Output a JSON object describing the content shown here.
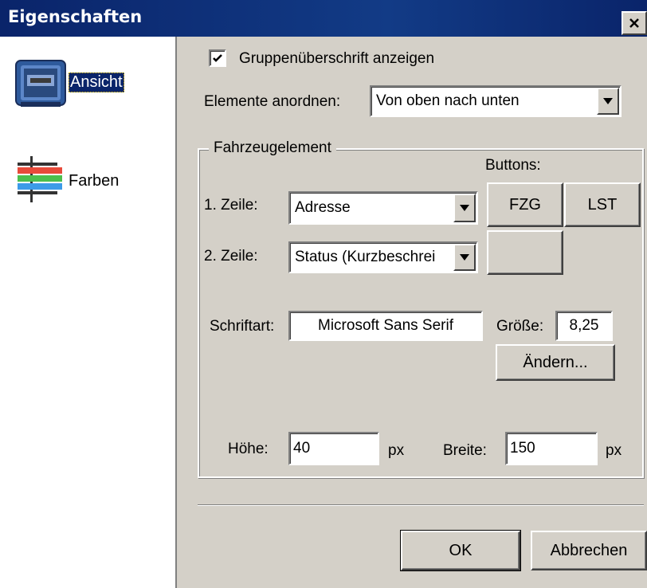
{
  "window": {
    "title": "Eigenschaften"
  },
  "sidebar": {
    "items": [
      {
        "label": "Ansicht",
        "icon": "display-icon",
        "selected": true
      },
      {
        "label": "Farben",
        "icon": "color-bars-icon",
        "selected": false
      }
    ]
  },
  "options": {
    "show_group_header_label": "Gruppenüberschrift anzeigen",
    "show_group_header_checked": true,
    "arrange_label": "Elemente anordnen:",
    "arrange_value": "Von oben nach unten"
  },
  "vehicle_element": {
    "group_title": "Fahrzeugelement",
    "buttons_label": "Buttons:",
    "row1_label": "1. Zeile:",
    "row1_value": "Adresse",
    "row2_label": "2. Zeile:",
    "row2_value": "Status (Kurzbeschrei",
    "btn_fzg": "FZG",
    "btn_lst": "LST",
    "btn_empty": "",
    "font_label": "Schriftart:",
    "font_value": "Microsoft Sans Serif",
    "size_label": "Größe:",
    "size_value": "8,25",
    "change_button": "Ändern...",
    "height_label": "Höhe:",
    "height_value": "40",
    "height_unit": "px",
    "width_label": "Breite:",
    "width_value": "150",
    "width_unit": "px"
  },
  "footer": {
    "ok": "OK",
    "cancel": "Abbrechen"
  },
  "colors": {
    "titlebar": "#0a246a",
    "face": "#d4d0c8",
    "selection": "#0a246a"
  }
}
